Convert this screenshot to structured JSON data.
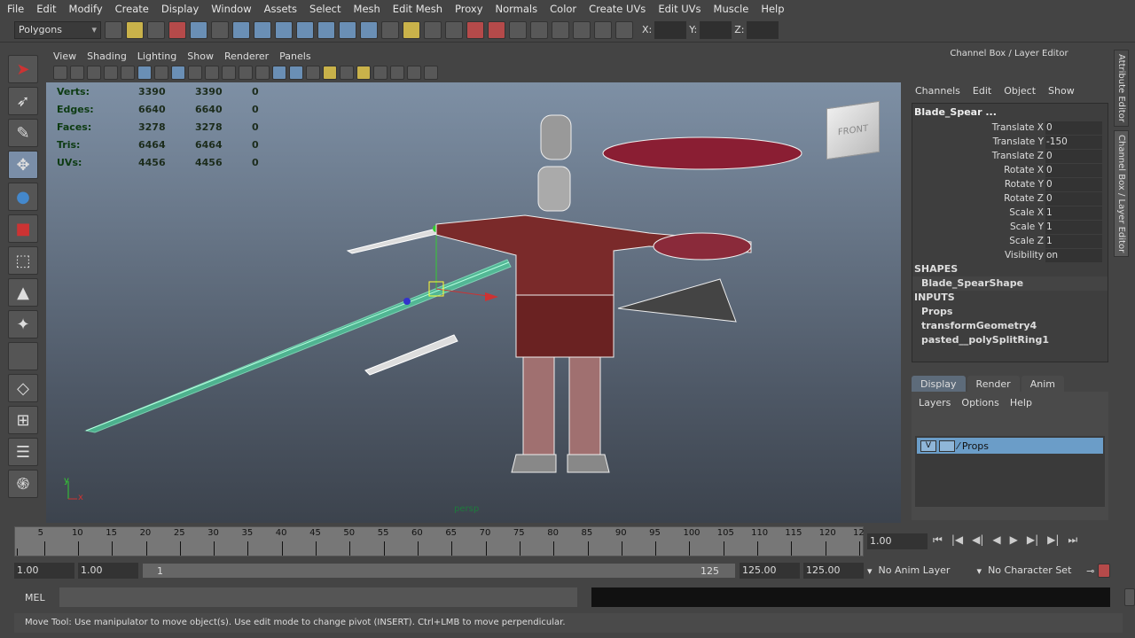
{
  "menubar": [
    "File",
    "Edit",
    "Modify",
    "Create",
    "Display",
    "Window",
    "Assets",
    "Select",
    "Mesh",
    "Edit Mesh",
    "Proxy",
    "Normals",
    "Color",
    "Create UVs",
    "Edit UVs",
    "Muscle",
    "Help"
  ],
  "status": {
    "mode": "Polygons",
    "x_label": "X:",
    "y_label": "Y:",
    "z_label": "Z:"
  },
  "panel_menu": [
    "View",
    "Shading",
    "Lighting",
    "Show",
    "Renderer",
    "Panels"
  ],
  "hud": [
    {
      "label": "Verts:",
      "a": "3390",
      "b": "3390",
      "c": "0"
    },
    {
      "label": "Edges:",
      "a": "6640",
      "b": "6640",
      "c": "0"
    },
    {
      "label": "Faces:",
      "a": "3278",
      "b": "3278",
      "c": "0"
    },
    {
      "label": "Tris:",
      "a": "6464",
      "b": "6464",
      "c": "0"
    },
    {
      "label": "UVs:",
      "a": "4456",
      "b": "4456",
      "c": "0"
    }
  ],
  "viewport": {
    "camera": "persp",
    "viewcube": "FRONT",
    "axis_y": "y",
    "axis_x": "x"
  },
  "channel_box": {
    "title": "Channel Box / Layer Editor",
    "menu": [
      "Channels",
      "Edit",
      "Object",
      "Show"
    ],
    "object": "Blade_Spear ...",
    "channels": [
      {
        "label": "Translate X",
        "value": "0"
      },
      {
        "label": "Translate Y",
        "value": "-150"
      },
      {
        "label": "Translate Z",
        "value": "0"
      },
      {
        "label": "Rotate X",
        "value": "0"
      },
      {
        "label": "Rotate Y",
        "value": "0"
      },
      {
        "label": "Rotate Z",
        "value": "0"
      },
      {
        "label": "Scale X",
        "value": "1"
      },
      {
        "label": "Scale Y",
        "value": "1"
      },
      {
        "label": "Scale Z",
        "value": "1"
      },
      {
        "label": "Visibility",
        "value": "on"
      }
    ],
    "shapes_header": "SHAPES",
    "shape": "Blade_SpearShape",
    "inputs_header": "INPUTS",
    "inputs": [
      "Props",
      "transformGeometry4",
      "pasted__polySplitRing1"
    ]
  },
  "layer_editor": {
    "tabs": [
      "Display",
      "Render",
      "Anim"
    ],
    "active_tab": "Display",
    "menu": [
      "Layers",
      "Options",
      "Help"
    ],
    "layers": [
      {
        "visible": "V",
        "name": "Props"
      }
    ]
  },
  "side_tabs": [
    "Attribute Editor",
    "Channel Box / Layer Editor"
  ],
  "timeline": {
    "ticks": [
      "5",
      "10",
      "15",
      "20",
      "25",
      "30",
      "35",
      "40",
      "45",
      "50",
      "55",
      "60",
      "65",
      "70",
      "75",
      "80",
      "85",
      "90",
      "95",
      "100",
      "105",
      "110",
      "115",
      "120",
      "12"
    ],
    "current_frame": "1.00"
  },
  "range": {
    "start": "1.00",
    "playback_start": "1.00",
    "bar_start": "1",
    "bar_end": "125",
    "playback_end": "125.00",
    "end": "125.00",
    "anim_layer": "No Anim Layer",
    "character_set": "No Character Set"
  },
  "mel": {
    "label": "MEL"
  },
  "help_line": "Move Tool: Use manipulator to move object(s). Use edit mode to change pivot (INSERT).  Ctrl+LMB to move perpendicular."
}
